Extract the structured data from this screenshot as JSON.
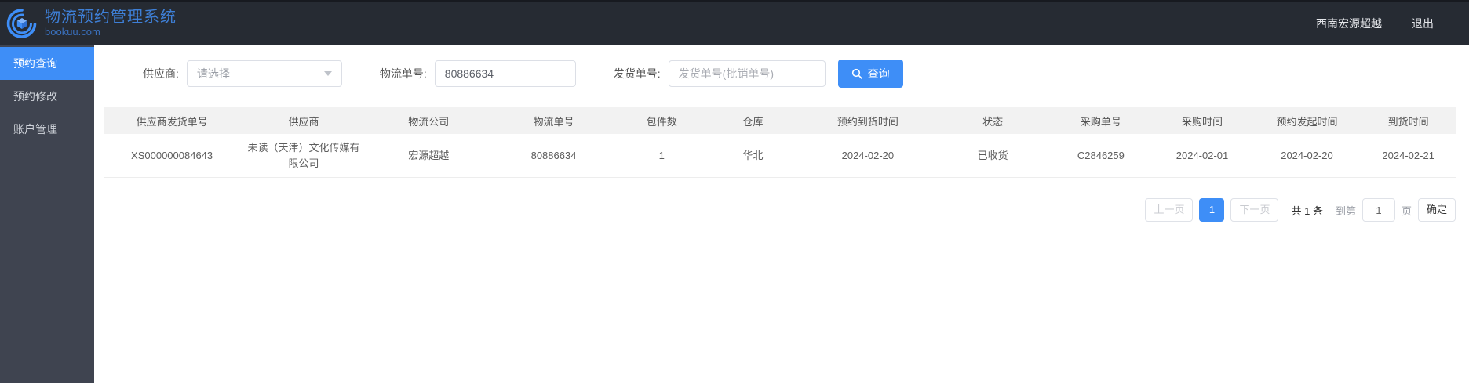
{
  "header": {
    "title": "物流预约管理系统",
    "subtitle": "bookuu.com",
    "user_name": "西南宏源超越",
    "logout_label": "退出"
  },
  "sidebar": {
    "items": [
      {
        "label": "预约查询",
        "active": true
      },
      {
        "label": "预约修改",
        "active": false
      },
      {
        "label": "账户管理",
        "active": false
      }
    ]
  },
  "filters": {
    "supplier_label": "供应商:",
    "supplier_placeholder": "请选择",
    "logistics_no_label": "物流单号:",
    "logistics_no_value": "80886634",
    "shipment_no_label": "发货单号:",
    "shipment_no_placeholder": "发货单号(批销单号)",
    "search_button_label": "查询"
  },
  "table": {
    "columns": [
      "供应商发货单号",
      "供应商",
      "物流公司",
      "物流单号",
      "包件数",
      "仓库",
      "预约到货时间",
      "状态",
      "采购单号",
      "采购时间",
      "预约发起时间",
      "到货时间"
    ],
    "rows": [
      [
        "XS000000084643",
        "未读（天津）文化传媒有限公司",
        "宏源超越",
        "80886634",
        "1",
        "华北",
        "2024-02-20",
        "已收货",
        "C2846259",
        "2024-02-01",
        "2024-02-20",
        "2024-02-21"
      ]
    ]
  },
  "pagination": {
    "prev_label": "上一页",
    "page": "1",
    "next_label": "下一页",
    "total_label": "共 1 条",
    "goto_prefix": "到第",
    "goto_value": "1",
    "goto_suffix": "页",
    "confirm_label": "确定"
  },
  "colors": {
    "accent": "#3e8ef7",
    "topbar_bg": "#262b33",
    "sidebar_bg": "#3f4450",
    "table_header_bg": "#f2f2f2",
    "brand_text": "#3e7fd6"
  }
}
